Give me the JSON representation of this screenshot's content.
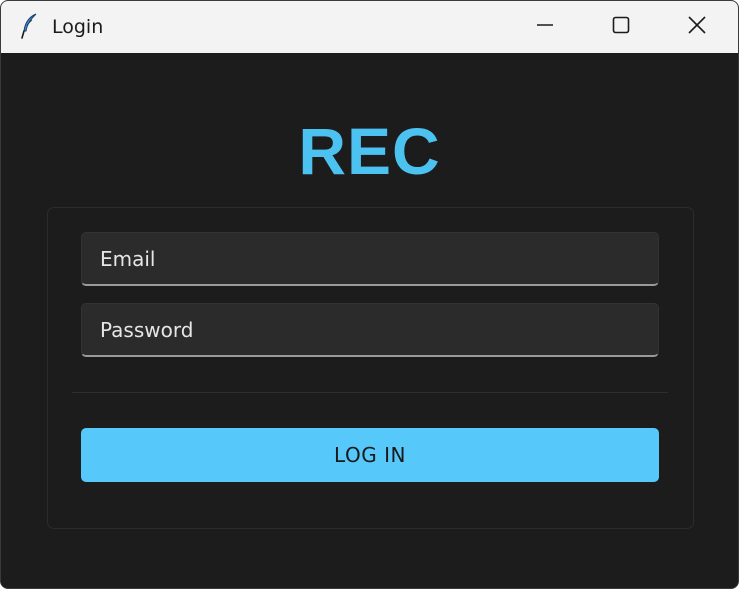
{
  "window": {
    "title": "Login",
    "controls": {
      "minimize": "minimize-icon",
      "maximize": "maximize-icon",
      "close": "close-icon"
    }
  },
  "app": {
    "logo_text": "REC"
  },
  "form": {
    "email": {
      "value": "",
      "placeholder": "Email"
    },
    "password": {
      "value": "",
      "placeholder": "Password"
    },
    "submit_label": "LOG IN"
  },
  "colors": {
    "accent": "#4cc2f1",
    "button": "#56c8fa",
    "background": "#1c1c1c",
    "input_bg": "#2b2b2b",
    "titlebar": "#f3f3f3"
  }
}
